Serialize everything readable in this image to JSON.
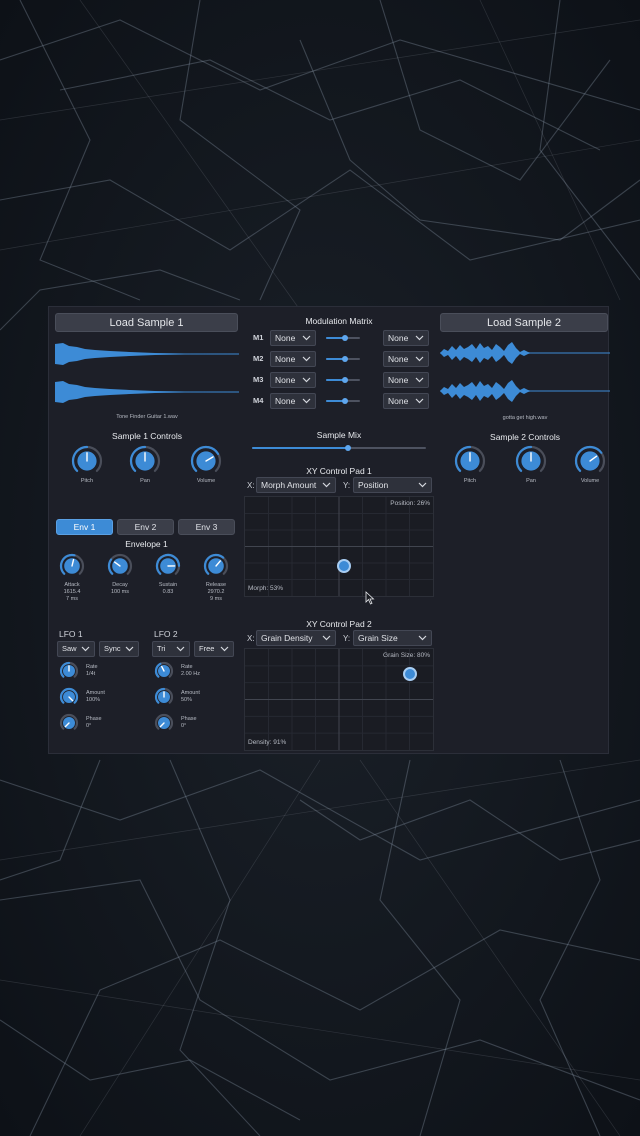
{
  "colors": {
    "accent": "#3d8bd6",
    "panel": "#1d1f28",
    "control": "#3b3e49"
  },
  "sample1": {
    "load_label": "Load Sample 1",
    "file_name": "Tone Finder Guitar 1.wav",
    "controls_title": "Sample 1 Controls",
    "knobs": [
      {
        "label": "Pitch",
        "value": 0.5
      },
      {
        "label": "Pan",
        "value": 0.5
      },
      {
        "label": "Volume",
        "value": 0.72
      }
    ]
  },
  "sample2": {
    "load_label": "Load Sample 2",
    "file_name": "gotta get high.wav",
    "controls_title": "Sample 2 Controls",
    "knobs": [
      {
        "label": "Pitch",
        "value": 0.5
      },
      {
        "label": "Pan",
        "value": 0.5
      },
      {
        "label": "Volume",
        "value": 0.7
      }
    ]
  },
  "mod_matrix": {
    "title": "Modulation Matrix",
    "rows": [
      {
        "label": "M1",
        "source": "None",
        "dest": "None",
        "amount": 0.55
      },
      {
        "label": "M2",
        "source": "None",
        "dest": "None",
        "amount": 0.55
      },
      {
        "label": "M3",
        "source": "None",
        "dest": "None",
        "amount": 0.55
      },
      {
        "label": "M4",
        "source": "None",
        "dest": "None",
        "amount": 0.55
      }
    ]
  },
  "sample_mix": {
    "label": "Sample Mix",
    "value": 0.55
  },
  "xy1": {
    "title": "XY Control Pad 1",
    "x_prefix": "X:",
    "x_param": "Morph Amount",
    "y_prefix": "Y:",
    "y_param": "Position",
    "x_readout": "Morph: 53%",
    "y_readout": "Position: 26%",
    "x_value": 0.53,
    "y_value": 0.26
  },
  "xy2": {
    "title": "XY Control Pad 2",
    "x_prefix": "X:",
    "x_param": "Grain Density",
    "y_prefix": "Y:",
    "y_param": "Grain Size",
    "x_readout": "Density: 91%",
    "y_readout": "Grain Size: 80%",
    "x_value": 0.91,
    "y_value": 0.8
  },
  "envelopes": {
    "tabs": [
      "Env 1",
      "Env 2",
      "Env 3"
    ],
    "active_tab": 0,
    "title": "Envelope 1",
    "knobs": [
      {
        "label": "Attack",
        "value_text": "1615.4",
        "value_text2": "7 ms",
        "value": 0.55
      },
      {
        "label": "Decay",
        "value_text": "100 ms",
        "value_text2": "",
        "value": 0.3
      },
      {
        "label": "Sustain",
        "value_text": "0.83",
        "value_text2": "",
        "value": 0.83
      },
      {
        "label": "Release",
        "value_text": "2970.2",
        "value_text2": "9 ms",
        "value": 0.65
      }
    ]
  },
  "lfo1": {
    "title": "LFO 1",
    "shape": "Saw",
    "mode": "Sync",
    "knobs": [
      {
        "label": "Rate",
        "value_text": "1/4t",
        "value": 0.5
      },
      {
        "label": "Amount",
        "value_text": "100%",
        "value": 1.0
      },
      {
        "label": "Phase",
        "value_text": "0°",
        "value": 0.0
      }
    ]
  },
  "lfo2": {
    "title": "LFO 2",
    "shape": "Tri",
    "mode": "Free",
    "knobs": [
      {
        "label": "Rate",
        "value_text": "2.00 Hz",
        "value": 0.4
      },
      {
        "label": "Amount",
        "value_text": "50%",
        "value": 0.5
      },
      {
        "label": "Phase",
        "value_text": "0°",
        "value": 0.0
      }
    ]
  }
}
